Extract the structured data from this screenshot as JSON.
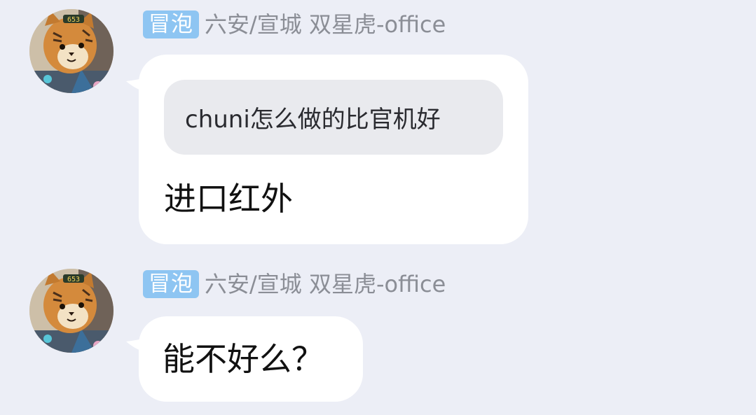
{
  "messages": [
    {
      "badge": "冒泡",
      "sender": "六安/宣城 双星虎-office",
      "quote": "chuni怎么做的比官机好",
      "text": "进口红外",
      "avatar_icon": "tiger-avatar"
    },
    {
      "badge": "冒泡",
      "sender": "六安/宣城 双星虎-office",
      "text": "能不好么？",
      "avatar_icon": "tiger-avatar"
    }
  ],
  "colors": {
    "background": "#eceef6",
    "badge": "#8ec5f2",
    "bubble": "#ffffff",
    "quote_bg": "#e9eaee",
    "sender_text": "#8b8e96"
  }
}
